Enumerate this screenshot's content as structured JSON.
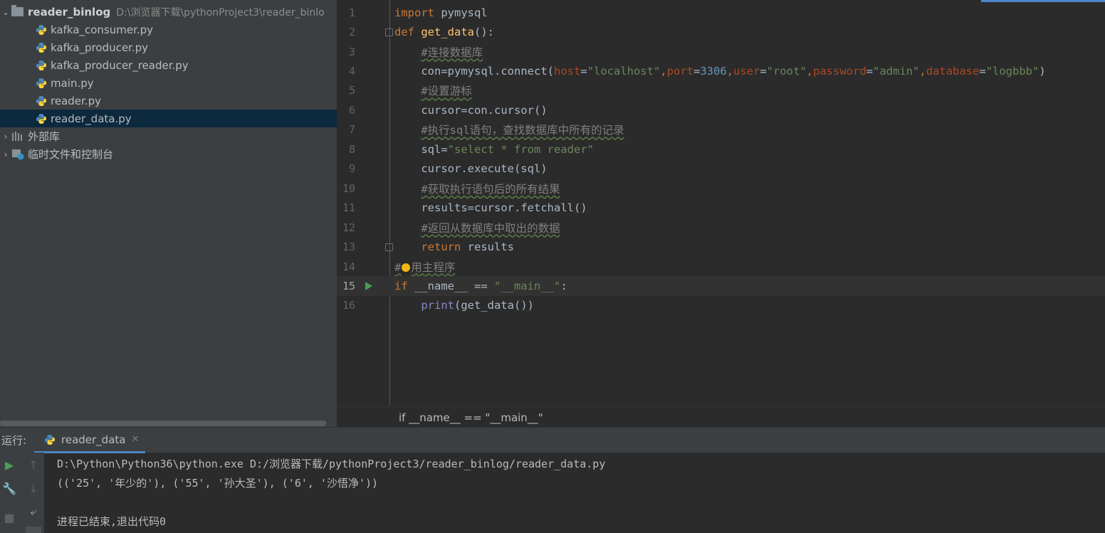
{
  "project": {
    "root_name": "reader_binlog",
    "root_path": "D:\\浏览器下载\\pythonProject3\\reader_binlo",
    "files": [
      {
        "label": "kafka_consumer.py"
      },
      {
        "label": "kafka_producer.py"
      },
      {
        "label": "kafka_producer_reader.py"
      },
      {
        "label": "main.py"
      },
      {
        "label": "reader.py"
      },
      {
        "label": "reader_data.py",
        "selected": true
      }
    ],
    "external_libs": "外部库",
    "scratches": "临时文件和控制台"
  },
  "editor": {
    "line_numbers": [
      "1",
      "2",
      "3",
      "4",
      "5",
      "6",
      "7",
      "8",
      "9",
      "10",
      "11",
      "12",
      "13",
      "14",
      "15",
      "16"
    ],
    "current_line": "15",
    "lines": [
      [
        {
          "t": "import",
          "c": "kw"
        },
        {
          "t": " pymysql",
          "c": "pl"
        }
      ],
      [
        {
          "t": "def",
          "c": "kw"
        },
        {
          "t": " ",
          "c": "pl"
        },
        {
          "t": "get_data",
          "c": "fn"
        },
        {
          "t": "():",
          "c": "pl"
        }
      ],
      [
        {
          "t": "    ",
          "c": "pl"
        },
        {
          "t": "#连接数据库",
          "c": "cmt"
        }
      ],
      [
        {
          "t": "    con",
          "c": "pl"
        },
        {
          "t": "=",
          "c": "pl"
        },
        {
          "t": "pymysql.connect(",
          "c": "pl"
        },
        {
          "t": "host",
          "c": "param"
        },
        {
          "t": "=",
          "c": "pl"
        },
        {
          "t": "\"localhost\"",
          "c": "str"
        },
        {
          "t": ",",
          "c": "kw"
        },
        {
          "t": "port",
          "c": "param"
        },
        {
          "t": "=",
          "c": "pl"
        },
        {
          "t": "3306",
          "c": "num"
        },
        {
          "t": ",",
          "c": "kw"
        },
        {
          "t": "user",
          "c": "param"
        },
        {
          "t": "=",
          "c": "pl"
        },
        {
          "t": "\"root\"",
          "c": "str"
        },
        {
          "t": ",",
          "c": "kw"
        },
        {
          "t": "password",
          "c": "param"
        },
        {
          "t": "=",
          "c": "pl"
        },
        {
          "t": "\"admin\"",
          "c": "str"
        },
        {
          "t": ",",
          "c": "kw"
        },
        {
          "t": "database",
          "c": "param"
        },
        {
          "t": "=",
          "c": "pl"
        },
        {
          "t": "\"logbbb\"",
          "c": "str"
        },
        {
          "t": ")",
          "c": "pl"
        }
      ],
      [
        {
          "t": "    ",
          "c": "pl"
        },
        {
          "t": "#设置游标",
          "c": "cmt"
        }
      ],
      [
        {
          "t": "    cursor",
          "c": "pl"
        },
        {
          "t": "=",
          "c": "pl"
        },
        {
          "t": "con.cursor()",
          "c": "pl"
        }
      ],
      [
        {
          "t": "    ",
          "c": "pl"
        },
        {
          "t": "#执行sql语句，查找数据库中所有的记录",
          "c": "cmt"
        }
      ],
      [
        {
          "t": "    sql",
          "c": "pl"
        },
        {
          "t": "=",
          "c": "pl"
        },
        {
          "t": "\"select * from reader\"",
          "c": "str"
        }
      ],
      [
        {
          "t": "    cursor.execute(sql)",
          "c": "pl"
        }
      ],
      [
        {
          "t": "    ",
          "c": "pl"
        },
        {
          "t": "#获取执行语句后的所有结果",
          "c": "cmt"
        }
      ],
      [
        {
          "t": "    results",
          "c": "pl"
        },
        {
          "t": "=",
          "c": "pl"
        },
        {
          "t": "cursor.fetchall()",
          "c": "pl"
        }
      ],
      [
        {
          "t": "    ",
          "c": "pl"
        },
        {
          "t": "#返回从数据库中取出的数据",
          "c": "cmt"
        }
      ],
      [
        {
          "t": "    ",
          "c": "pl"
        },
        {
          "t": "return",
          "c": "kw"
        },
        {
          "t": " results",
          "c": "pl"
        }
      ],
      [
        {
          "t": "#",
          "c": "cmt"
        },
        {
          "t": "",
          "c": "bulb"
        },
        {
          "t": "用主程序",
          "c": "cmt"
        }
      ],
      [
        {
          "t": "if",
          "c": "kw"
        },
        {
          "t": " ",
          "c": "pl"
        },
        {
          "t": "__name__",
          "c": "pl"
        },
        {
          "t": " == ",
          "c": "pl"
        },
        {
          "t": "\"__main__\"",
          "c": "str"
        },
        {
          "t": ":",
          "c": "pl"
        }
      ],
      [
        {
          "t": "    ",
          "c": "pl"
        },
        {
          "t": "print",
          "c": "fn2"
        },
        {
          "t": "(get_data())",
          "c": "pl"
        }
      ]
    ],
    "breadcrumb": "if __name__ == \"__main__\""
  },
  "run": {
    "label": "运行:",
    "tab_label": "reader_data",
    "output": [
      "D:\\Python\\Python36\\python.exe D:/浏览器下载/pythonProject3/reader_binlog/reader_data.py",
      "(('25', '年少的'), ('55', '孙大圣'), ('6', '沙悟净'))",
      "",
      "进程已结束,退出代码0"
    ]
  },
  "colors": {
    "keyword": "#cc7832",
    "function": "#ffc66d",
    "string": "#6a8759",
    "number": "#6897bb",
    "param": "#aa4926",
    "comment": "#808080",
    "selection": "#0d293e",
    "accent": "#4a88c7"
  }
}
